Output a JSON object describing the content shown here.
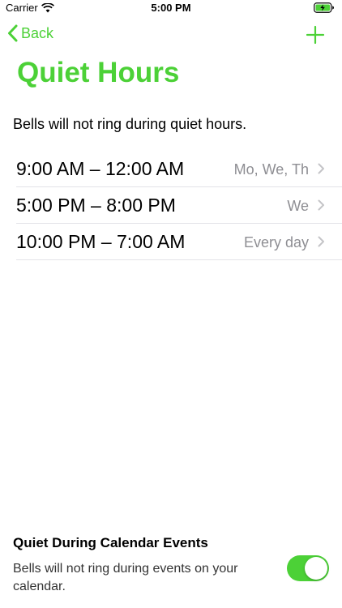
{
  "status_bar": {
    "carrier": "Carrier",
    "time": "5:00 PM",
    "icons": [
      "wifi-icon",
      "battery-charging-icon"
    ]
  },
  "nav": {
    "back_label": "Back",
    "back_icon": "chevron-left-icon",
    "add_icon": "plus-icon"
  },
  "page": {
    "title": "Quiet Hours",
    "description": "Bells will not ring during quiet hours."
  },
  "schedules": [
    {
      "time": "9:00 AM – 12:00 AM",
      "days": "Mo, We, Th"
    },
    {
      "time": "5:00 PM – 8:00 PM",
      "days": "We"
    },
    {
      "time": "10:00 PM – 7:00 AM",
      "days": "Every day"
    }
  ],
  "calendar": {
    "title": "Quiet During Calendar Events",
    "description": "Bells will not ring during events on your calendar.",
    "toggle_on": true
  },
  "colors": {
    "accent": "#4cd137",
    "secondary_text": "#8e8e93",
    "separator": "#e3e3e8"
  }
}
